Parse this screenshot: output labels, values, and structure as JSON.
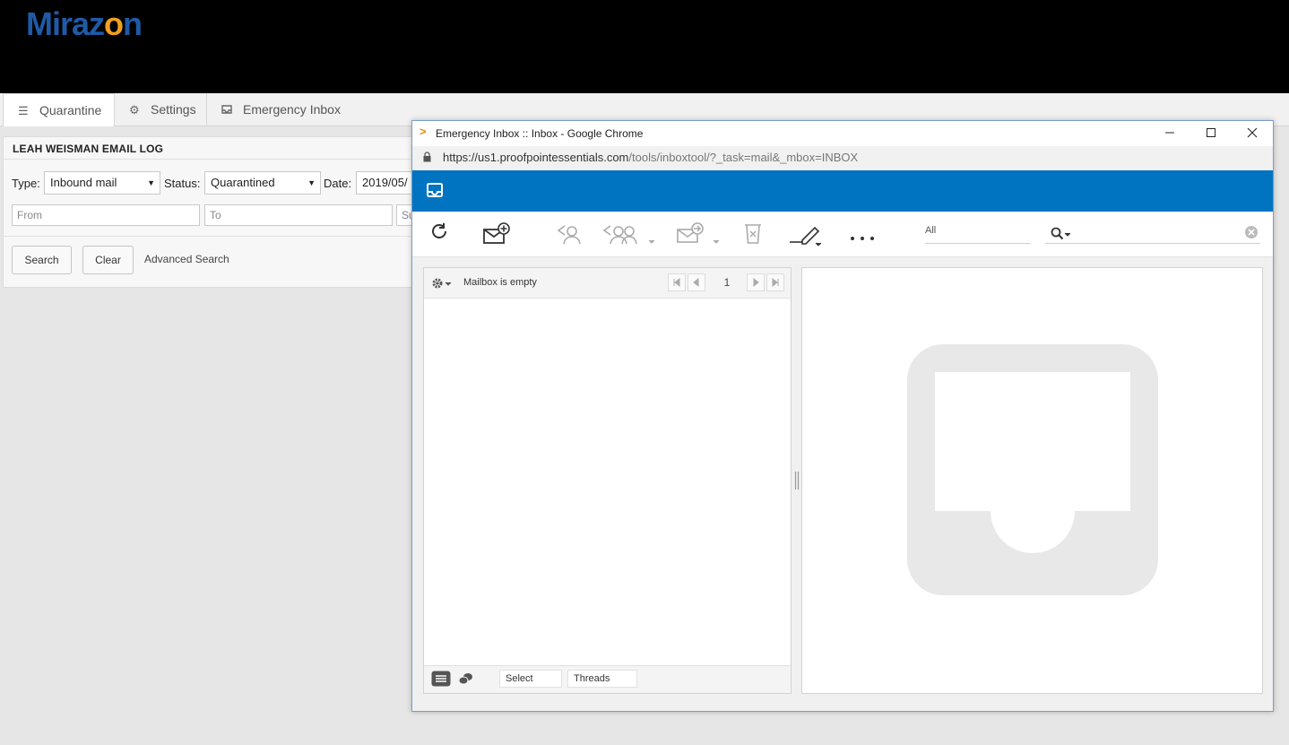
{
  "brand": {
    "logo_text_1": "Miraz",
    "logo_text_2": "o",
    "logo_text_3": "n"
  },
  "tabs": [
    {
      "label": "Quarantine",
      "icon": "list-icon"
    },
    {
      "label": "Settings",
      "icon": "gear-icon"
    },
    {
      "label": "Emergency Inbox",
      "icon": "inbox-icon"
    }
  ],
  "email_log": {
    "title": "LEAH WEISMAN EMAIL LOG",
    "type_label": "Type:",
    "type_value": "Inbound mail",
    "status_label": "Status:",
    "status_value": "Quarantined",
    "date_label": "Date:",
    "date_value": "2019/05/",
    "from_placeholder": "From",
    "to_placeholder": "To",
    "subject_placeholder": "Su",
    "search_button": "Search",
    "clear_button": "Clear",
    "advanced_link": "Advanced Search"
  },
  "popup": {
    "title": "Emergency Inbox :: Inbox - Google Chrome",
    "url_host": "https://us1.proofpointessentials.com",
    "url_path": "/tools/inboxtool/?_task=mail&_mbox=INBOX",
    "filter_value": "All",
    "mailbox_status": "Mailbox is empty",
    "page_number": "1",
    "select_label": "Select",
    "threads_label": "Threads"
  },
  "colors": {
    "app_bar": "#0074c1",
    "logo_blue": "#1f5aa6",
    "logo_orange": "#f0a020"
  }
}
